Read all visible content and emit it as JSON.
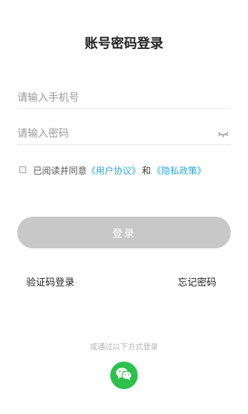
{
  "header": {
    "title": "账号密码登录"
  },
  "form": {
    "phone_placeholder": "请输入手机号",
    "password_placeholder": "请输入密码",
    "password_toggle_icon": "eye-closed-icon"
  },
  "agreement": {
    "prefix": "已阅读并同意",
    "user_agreement": "《用户协议》",
    "and": "和",
    "privacy_policy": "《隐私政策》",
    "checked": false
  },
  "actions": {
    "login_label": "登录",
    "sms_login_label": "验证码登录",
    "forgot_password_label": "忘记密码"
  },
  "other_login": {
    "label": "或通过以下方式登录",
    "wechat_icon": "wechat-icon"
  },
  "colors": {
    "link": "#2aa6e0",
    "button_disabled": "#c8c8c8",
    "wechat": "#2dc14a"
  }
}
